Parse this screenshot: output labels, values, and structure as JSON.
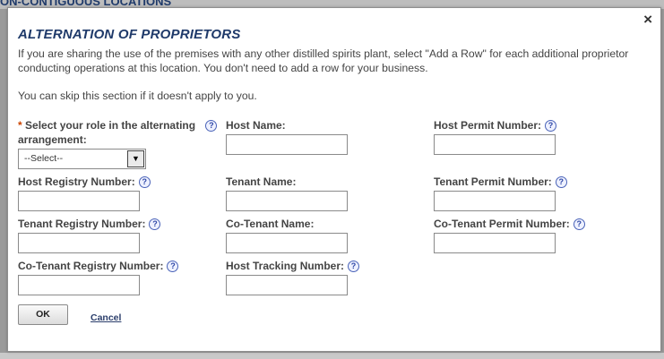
{
  "background": {
    "title_fragment": "ON-CONTIGUOUS LOCATIONS"
  },
  "dialog": {
    "close_label": "×",
    "title": "ALTERNATION OF PROPRIETORS",
    "description": "If you are sharing the use of the premises with any other distilled spirits plant, select \"Add a Row\" for each additional proprietor conducting operations at this location. You don't need to add a row for your business.",
    "skip_note": "You can skip this section if it doesn't apply to you.",
    "help_glyph": "?",
    "required_mark": "*",
    "role": {
      "label_line1": "Select your role in the alternating",
      "label_line2": "arrangement:",
      "selected_value": "--Select--",
      "dropdown_glyph": "▼"
    },
    "fields": {
      "host_name": "Host Name:",
      "host_permit": "Host Permit Number:",
      "host_registry": "Host Registry Number:",
      "tenant_name": "Tenant Name:",
      "tenant_permit": "Tenant Permit Number:",
      "tenant_registry": "Tenant Registry Number:",
      "cotenant_name": "Co-Tenant Name:",
      "cotenant_permit": "Co-Tenant Permit Number:",
      "cotenant_registry": "Co-Tenant Registry Number:",
      "host_tracking": "Host Tracking Number:"
    },
    "buttons": {
      "ok": "OK",
      "cancel": "Cancel"
    }
  },
  "colors": {
    "title": "#1f3a6a",
    "text": "#444444",
    "required": "#cc4400",
    "help": "#2e47a6"
  }
}
